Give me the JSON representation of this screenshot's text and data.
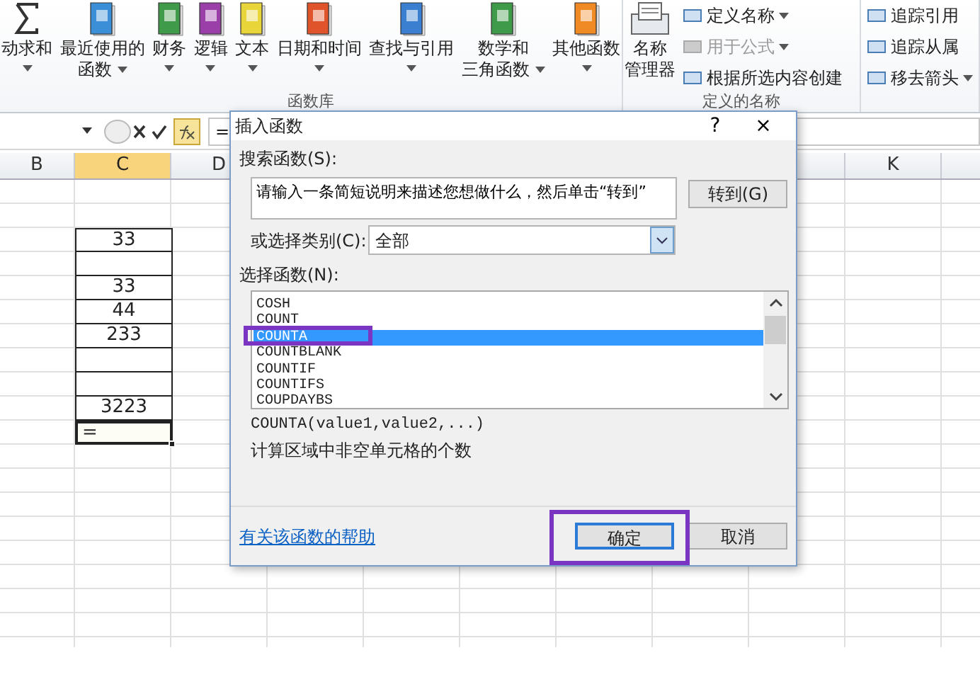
{
  "ribbon": {
    "groups": [
      {
        "label": "函数库",
        "items": [
          {
            "label": "动求和",
            "dropdown": true
          },
          {
            "color": "#3a8fd6",
            "label": "最近使用的",
            "label2": "函数",
            "dropdown": true
          },
          {
            "color": "#3f9a4a",
            "label": "财务",
            "dropdown": true
          },
          {
            "color": "#9a3fa8",
            "label": "逻辑",
            "dropdown": true
          },
          {
            "color": "#e8d53a",
            "label": "文本",
            "dropdown": true
          },
          {
            "color": "#e0542c",
            "label": "日期和时间",
            "dropdown": true
          },
          {
            "color": "#3a7fd0",
            "label": "查找与引用",
            "dropdown": true
          },
          {
            "color": "#3f9a4a",
            "label": "数学和",
            "label2": "三角函数",
            "dropdown": true
          },
          {
            "color": "#f08a24",
            "label": "其他函数",
            "dropdown": true
          }
        ]
      },
      {
        "label": "定义的名称",
        "items": [
          {
            "label": "名称",
            "label2": "管理器",
            "dropdown": false
          }
        ],
        "small_items": [
          {
            "label": "定义名称",
            "disabled": false,
            "dropdown": true
          },
          {
            "label": "用于公式",
            "disabled": true,
            "dropdown": true
          },
          {
            "label": "根据所选内容创建",
            "disabled": false,
            "dropdown": false
          }
        ]
      },
      {
        "small_items": [
          {
            "label": "追踪引用",
            "disabled": false,
            "dropdown": false
          },
          {
            "label": "追踪从属",
            "disabled": false,
            "dropdown": false
          },
          {
            "label": "移去箭头",
            "disabled": false,
            "dropdown": true
          }
        ]
      }
    ]
  },
  "formula_bar": {
    "formula": "="
  },
  "sheet": {
    "columns": [
      {
        "label": "B",
        "selected": false
      },
      {
        "label": "C",
        "selected": true
      },
      {
        "label": "D",
        "selected": false
      },
      {
        "label": "K",
        "selected": false
      }
    ],
    "c_cells": [
      {
        "value": "33",
        "active": false
      },
      {
        "active": false
      },
      {
        "value": "33",
        "active": false
      },
      {
        "value": "44",
        "active": false
      },
      {
        "value": "233",
        "active": false
      },
      {
        "active": false
      },
      {
        "active": false
      },
      {
        "value": "3223",
        "active": false
      },
      {
        "value": "=",
        "active": true
      }
    ]
  },
  "dialog": {
    "title": "插入函数",
    "help": "?",
    "close": "×",
    "search_label": "搜索函数(S):",
    "search_value": "请输入一条简短说明来描述您想做什么，然后单击“转到”",
    "go_button": "转到(G)",
    "category_label": "或选择类别(C):",
    "category_value": "全部",
    "functions_label": "选择函数(N):",
    "functions": [
      {
        "name": "COSH",
        "selected": false,
        "highlighted": false
      },
      {
        "name": "COUNT",
        "selected": false,
        "highlighted": false
      },
      {
        "name": "COUNTA",
        "selected": true,
        "highlighted": true
      },
      {
        "name": "COUNTBLANK",
        "selected": false,
        "highlighted": false
      },
      {
        "name": "COUNTIF",
        "selected": false,
        "highlighted": false
      },
      {
        "name": "COUNTIFS",
        "selected": false,
        "highlighted": false
      },
      {
        "name": "COUPDAYBS",
        "selected": false,
        "highlighted": false
      }
    ],
    "signature": "COUNTA(value1,value2,...)",
    "description": "计算区域中非空单元格的个数",
    "help_link": "有关该函数的帮助",
    "buttons": [
      {
        "label": "确定",
        "focused": true,
        "highlighted": true
      },
      {
        "label": "取消",
        "focused": false,
        "highlighted": false
      }
    ]
  }
}
